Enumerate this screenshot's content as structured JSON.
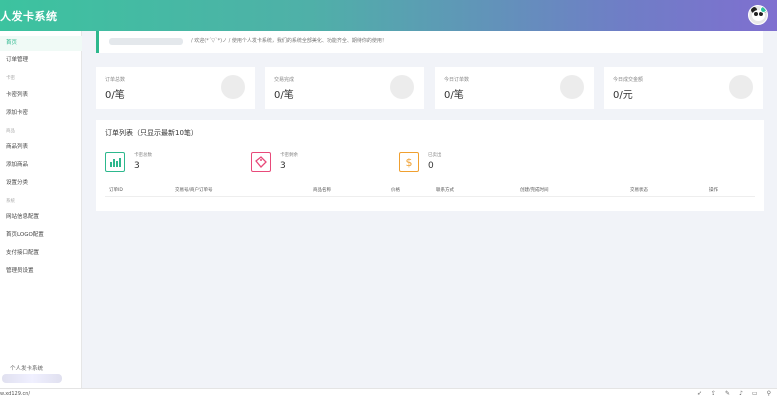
{
  "app": {
    "title": "人发卡系统"
  },
  "sidebar": {
    "items": [
      {
        "label": "首页",
        "active": true
      },
      {
        "label": "订单管理"
      },
      {
        "group": "卡密"
      },
      {
        "label": "卡密列表"
      },
      {
        "label": "添加卡密"
      },
      {
        "group": "商品"
      },
      {
        "label": "商品列表"
      },
      {
        "label": "添加商品"
      },
      {
        "label": "设置分类"
      },
      {
        "group": "系统"
      },
      {
        "label": "网站信息配置"
      },
      {
        "label": "首页LOGO配置"
      },
      {
        "label": "支付接口配置"
      },
      {
        "label": "管理员设置"
      }
    ],
    "footer": "个人发卡系统"
  },
  "welcome": {
    "text": "/ 欢迎(*´▽`*)ノ / 使用个人发卡系统，我们的系统全部美化、功能齐全、期待你的使用！"
  },
  "stats": [
    {
      "label": "订单总数",
      "value": "0/笔"
    },
    {
      "label": "交易完成",
      "value": "0/笔"
    },
    {
      "label": "今日订单数",
      "value": "0/笔"
    },
    {
      "label": "今日成交金额",
      "value": "0/元"
    }
  ],
  "orders_panel": {
    "title": "订单列表（只显示最新10笔）",
    "mini_stats": [
      {
        "label": "卡密总数",
        "value": "3",
        "icon": "bar-chart-icon",
        "color": "#2db88d"
      },
      {
        "label": "卡密剩余",
        "value": "3",
        "icon": "tag-icon",
        "color": "#e84a7a"
      },
      {
        "label": "已卖出",
        "value": "0",
        "icon": "dollar-icon",
        "color": "#f0a030"
      }
    ],
    "columns": [
      "订单ID",
      "交易号/商户订单号",
      "商品名称",
      "价格",
      "联系方式",
      "创建/完成时间",
      "交易状态",
      "操作"
    ]
  },
  "statusbar": {
    "url": "w.xd129.cn/",
    "icons": [
      "rocket-icon",
      "share-icon",
      "edit-icon",
      "volume-icon",
      "window-icon",
      "search-icon"
    ]
  }
}
